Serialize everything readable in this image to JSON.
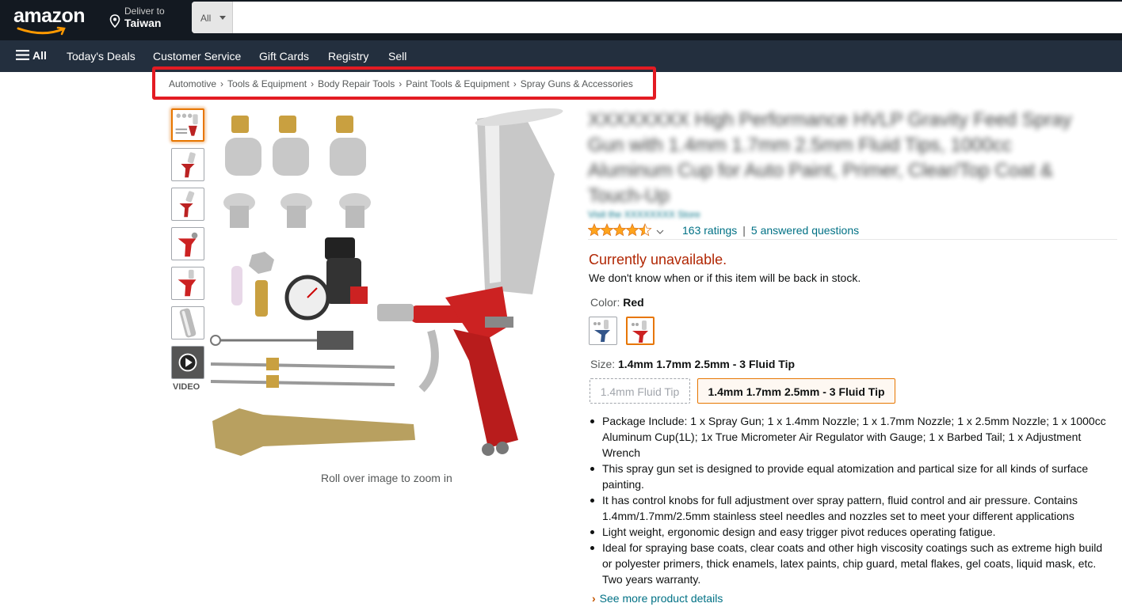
{
  "nav": {
    "logo": "amazon",
    "deliver_line1": "Deliver to",
    "deliver_line2": "Taiwan",
    "search_category": "All",
    "search_placeholder": "",
    "menu_all": "All",
    "menu_items": [
      "Today's Deals",
      "Customer Service",
      "Gift Cards",
      "Registry",
      "Sell"
    ]
  },
  "breadcrumb": [
    "Automotive",
    "Tools & Equipment",
    "Body Repair Tools",
    "Paint Tools & Equipment",
    "Spray Guns & Accessories"
  ],
  "gallery": {
    "video_label": "VIDEO",
    "zoom_hint": "Roll over image to zoom in",
    "thumb_icons": [
      "kit-thumbnail-icon",
      "spray-gun-thumbnail-icon",
      "spray-gun-thumbnail-icon",
      "red-spray-gun-thumbnail-icon",
      "red-spray-gun-thumbnail-icon",
      "aluminum-cup-thumbnail-icon",
      "video-play-icon"
    ]
  },
  "product": {
    "title": "XXXXXXXX High Performance HVLP Gravity Feed Spray Gun with 1.4mm 1.7mm 2.5mm Fluid Tips, 1000cc Aluminum Cup for Auto Paint, Primer, Clear/Top Coat & Touch-Up",
    "brand": "Visit the XXXXXXXX Store",
    "rating_value": 4.5,
    "ratings_text": "163 ratings",
    "questions_text": "5 answered questions",
    "availability": "Currently unavailable.",
    "stock_note": "We don't know when or if this item will be back in stock.",
    "color_label": "Color:",
    "color_value": "Red",
    "size_label": "Size:",
    "size_value": "1.4mm 1.7mm 2.5mm - 3 Fluid Tip",
    "size_options": [
      "1.4mm Fluid Tip",
      "1.4mm 1.7mm 2.5mm - 3 Fluid Tip"
    ],
    "bullets": [
      "Package Include: 1 x Spray Gun; 1 x 1.4mm Nozzle; 1 x 1.7mm Nozzle; 1 x 2.5mm Nozzle; 1 x 1000cc Aluminum Cup(1L); 1x True Micrometer Air Regulator with Gauge; 1 x Barbed Tail; 1 x Adjustment Wrench",
      "This spray gun set is designed to provide equal atomization and partical size for all kinds of surface painting.",
      "It has control knobs for full adjustment over spray pattern, fluid control and air pressure. Contains 1.4mm/1.7mm/2.5mm stainless steel needles and nozzles set to meet your different applications",
      "Light weight, ergonomic design and easy trigger pivot reduces operating fatigue.",
      "Ideal for spraying base coats, clear coats and other high viscosity coatings such as extreme high build or polyester primers, thick enamels, latex paints, chip guard, metal flakes, gel coats, liquid mask, etc. Two years warranty."
    ],
    "see_more": "See more product details"
  },
  "colors": {
    "nav_dark": "#131921",
    "nav_sub": "#232f3e",
    "link": "#007185",
    "unavailable": "#b12704",
    "selected": "#e77600",
    "highlight_box": "#e31b23",
    "star": "#ffa41c"
  }
}
